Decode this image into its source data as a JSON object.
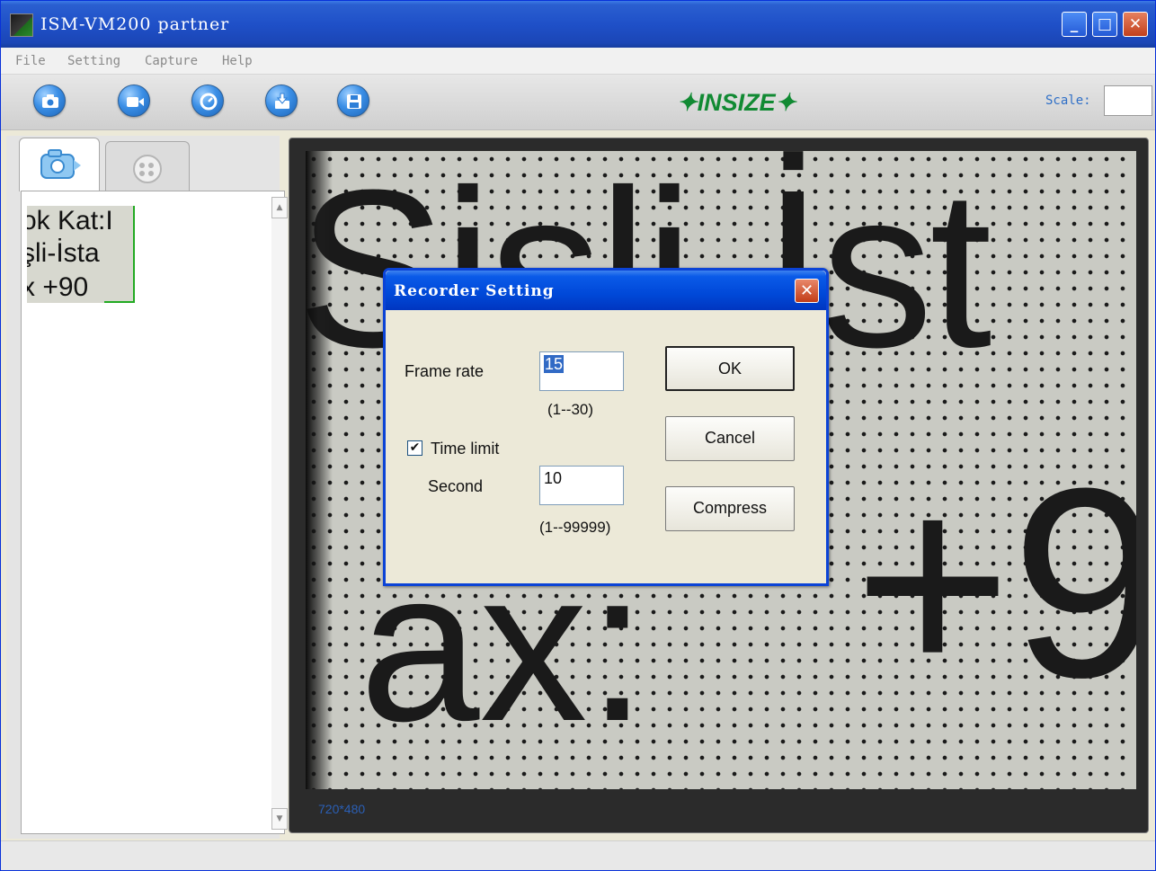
{
  "window": {
    "title": "ISM-VM200 partner",
    "controls": {
      "minimize": "_",
      "maximize": "□",
      "close": "✕"
    }
  },
  "menu": {
    "items": [
      "File",
      "Setting",
      "Capture",
      "Help"
    ]
  },
  "toolbar": {
    "buttons": [
      "camera-icon",
      "video-icon",
      "timer-icon",
      "import-icon",
      "save-icon"
    ],
    "brand": "✦INSIZE✦",
    "scale_label": "Scale:",
    "scale_value": ""
  },
  "left_panel": {
    "tabs": [
      "photo-tab-icon",
      "video-tab-icon"
    ],
    "thumbnail_lines": [
      "ok Kat:I",
      "şli-İsta",
      "x +90"
    ],
    "scroll": {
      "up": "▲",
      "down": "▼"
    }
  },
  "viewer": {
    "content_lines": [
      "Sisli-İst",
      "+9",
      "ax:"
    ],
    "resolution": "720*480"
  },
  "dialog": {
    "title": "Recorder Setting",
    "close": "✕",
    "frame_rate_label": "Frame rate",
    "frame_rate_value": "15",
    "frame_rate_range": "(1--30)",
    "time_limit_label": "Time limit",
    "time_limit_checked": "✔",
    "second_label": "Second",
    "second_value": "10",
    "second_range": "(1--99999)",
    "ok_label": "OK",
    "cancel_label": "Cancel",
    "compress_label": "Compress"
  },
  "colors": {
    "title_blue": "#1f50c8",
    "brand_green": "#118a33",
    "dialog_border": "#0b43d6"
  }
}
